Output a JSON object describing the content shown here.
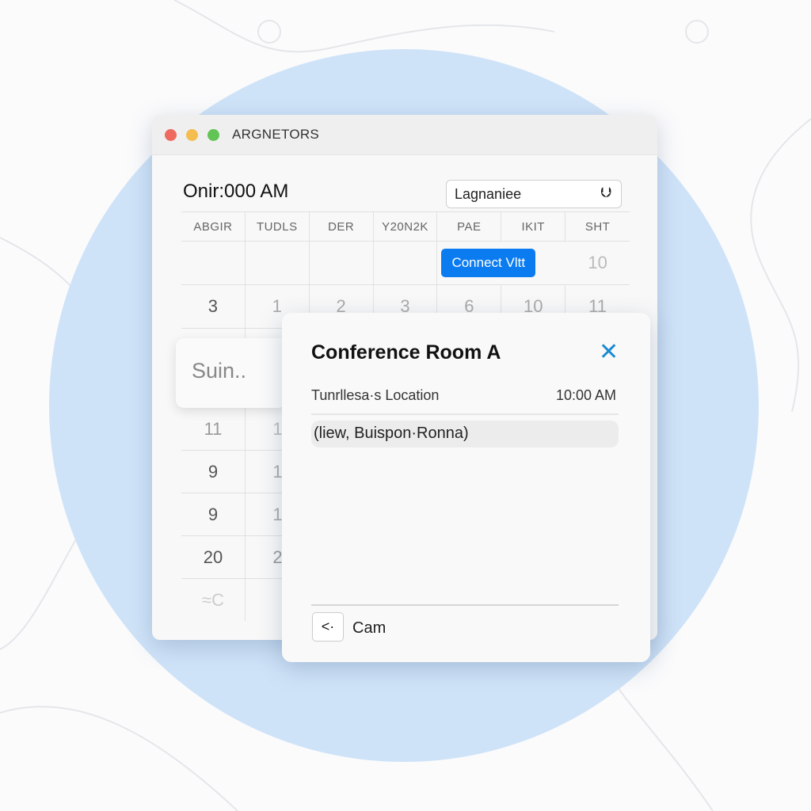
{
  "colors": {
    "accent": "#0b7cf0",
    "background_circle": "#cfe3f8",
    "close": "#1a8ad0"
  },
  "window": {
    "title": "ARGNETORS",
    "heading": "Onir:000 AM",
    "dropdown": {
      "value": "Lagnaniee",
      "icon": "download-chevron-icon"
    }
  },
  "calendar": {
    "headers": [
      "ABGIR",
      "TUDLS",
      "DER",
      "Y20N2K",
      "PAE",
      "IKIT",
      "SHT"
    ],
    "row1": {
      "button": "Connect Vltt",
      "last": "10"
    },
    "row2": [
      "3",
      "1",
      "2",
      "3",
      "6",
      "10",
      "11"
    ],
    "rows": [
      [
        "11",
        "1"
      ],
      [
        "9",
        "1"
      ],
      [
        "9",
        "1"
      ],
      [
        "20",
        "2"
      ],
      [
        "≈C",
        ""
      ]
    ]
  },
  "suggestion": {
    "text": "Suin.."
  },
  "popup": {
    "title": "Conference Room A",
    "location": "Tunrllesa·s Location",
    "time": "10:00 AM",
    "attendees": "(liew, Buispon·Ronna)",
    "footer_label": "Cam",
    "footer_icon": "share-icon"
  }
}
